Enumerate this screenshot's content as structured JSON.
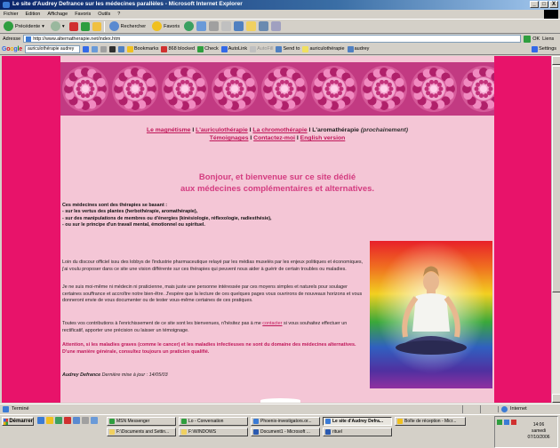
{
  "window": {
    "title": "Le site d'Audrey Defrance sur les médecines parallèles - Microsoft Internet Explorer",
    "controls": [
      "_",
      "□",
      "X"
    ]
  },
  "menu": {
    "items": [
      "Fichier",
      "Edition",
      "Affichage",
      "Favoris",
      "Outils",
      "?"
    ]
  },
  "toolbar": {
    "back": "Précédente",
    "search": "Rechercher",
    "favorites": "Favoris"
  },
  "address": {
    "label": "Adresse",
    "url": "http://www.alternatherapie.net/index.htm",
    "go": "OK",
    "links": "Liens"
  },
  "google_toolbar": {
    "logo": [
      "G",
      "o",
      "o",
      "g",
      "l",
      "e"
    ],
    "query": "auriculothérapie audrey",
    "bookmarks": "Bookmarks",
    "blocked": "868 blocked",
    "check": "Check",
    "autolink": "AutoLink",
    "autofill": "AutoFill",
    "sendto": "Send to",
    "term1": "auriculothérapie",
    "term2": "audrey",
    "settings": "Settings"
  },
  "nav": {
    "magnetisme": "Le magnétisme",
    "auriculo": "L'auriculothérapie",
    "chromo": "La chromothérapie",
    "sep": "I",
    "aroma": "L'aromathérapie",
    "prochainement": "(prochainement)",
    "temoignages": "Témoignages",
    "contact": "Contactez-moi",
    "english": "English version"
  },
  "welcome": {
    "line1": "Bonjour, et bienvenue sur ce site dédié",
    "line2": "aux médecines complémentaires et alternatives."
  },
  "medicines": {
    "intro": "Ces médecines sont des thérapies se basant :",
    "items": [
      "- sur les vertus des plantes (herbothérapie, aromathérapie),",
      "- sur des manipulations de membres ou d'énergies (kinésiologie, réflexologie, radiesthésie),",
      "- ou sur le principe d'un travail mental, émotionnel ou spirituel."
    ]
  },
  "body": {
    "p1": "Loin du discour officiel issu des lobbys de l'industrie pharmaceutique relayé par les médias muselés par les enjeux politiques et économiques, j'ai voulu proposer dans ce site une vision différente sur ces thérapies qui peuvent nous aider à guérir de certain troubles ou maladies.",
    "p2": "Je ne suis moi-même ni médecin ni praticienne, mais juste une personne intéressée par ces moyens simples et naturels pour soulager certaines souffrance et accroître notre bien-être. J'espère que la lecture de ces quelques pages vous ouvrirons de nouveaux horizons et vous donneront envie de vous documenter ou de tester vous-même certaines de ces pratiques.",
    "p3_before": "Toutes vos contributions à l'enrichissement de ce site sont les bienvenues, n'hésitez pas à me ",
    "p3_link": "contacter",
    "p3_after": " si vous souhaitez effectuer un rectificatif, apporter une précision ou laisser un témoignage.",
    "attention1": "Attention, si les maladies graves (comme le cancer) et les maladies infectieuses ne sont du domaine des médecines alternatives.",
    "attention2": "D'une manière générale, consultez toujours un praticien qualifié.",
    "author": "Audrey Defrance",
    "updated": "Dernière mise à jour : 14/05/03"
  },
  "status": {
    "text": "Terminé",
    "zone": "Internet"
  },
  "taskbar": {
    "start": "Démarrer",
    "tasks": [
      "MSN Messenger",
      "Lo - Conversation",
      "Phoenix-investigators.or...",
      "Le site d'Audrey Defra...",
      "Boîte de réception - Micr...",
      "F:\\Documents and Settin...",
      "F:\\WINDOWS",
      "Document1 - Microsoft ...",
      "rituel"
    ],
    "clock": {
      "time": "14:06",
      "day": "samedi",
      "date": "07/10/2006"
    }
  },
  "colors": {
    "page_bg": "#e8136a",
    "content_bg": "#f4c6d6",
    "accent": "#c0185a",
    "welcome": "#d43c80"
  }
}
